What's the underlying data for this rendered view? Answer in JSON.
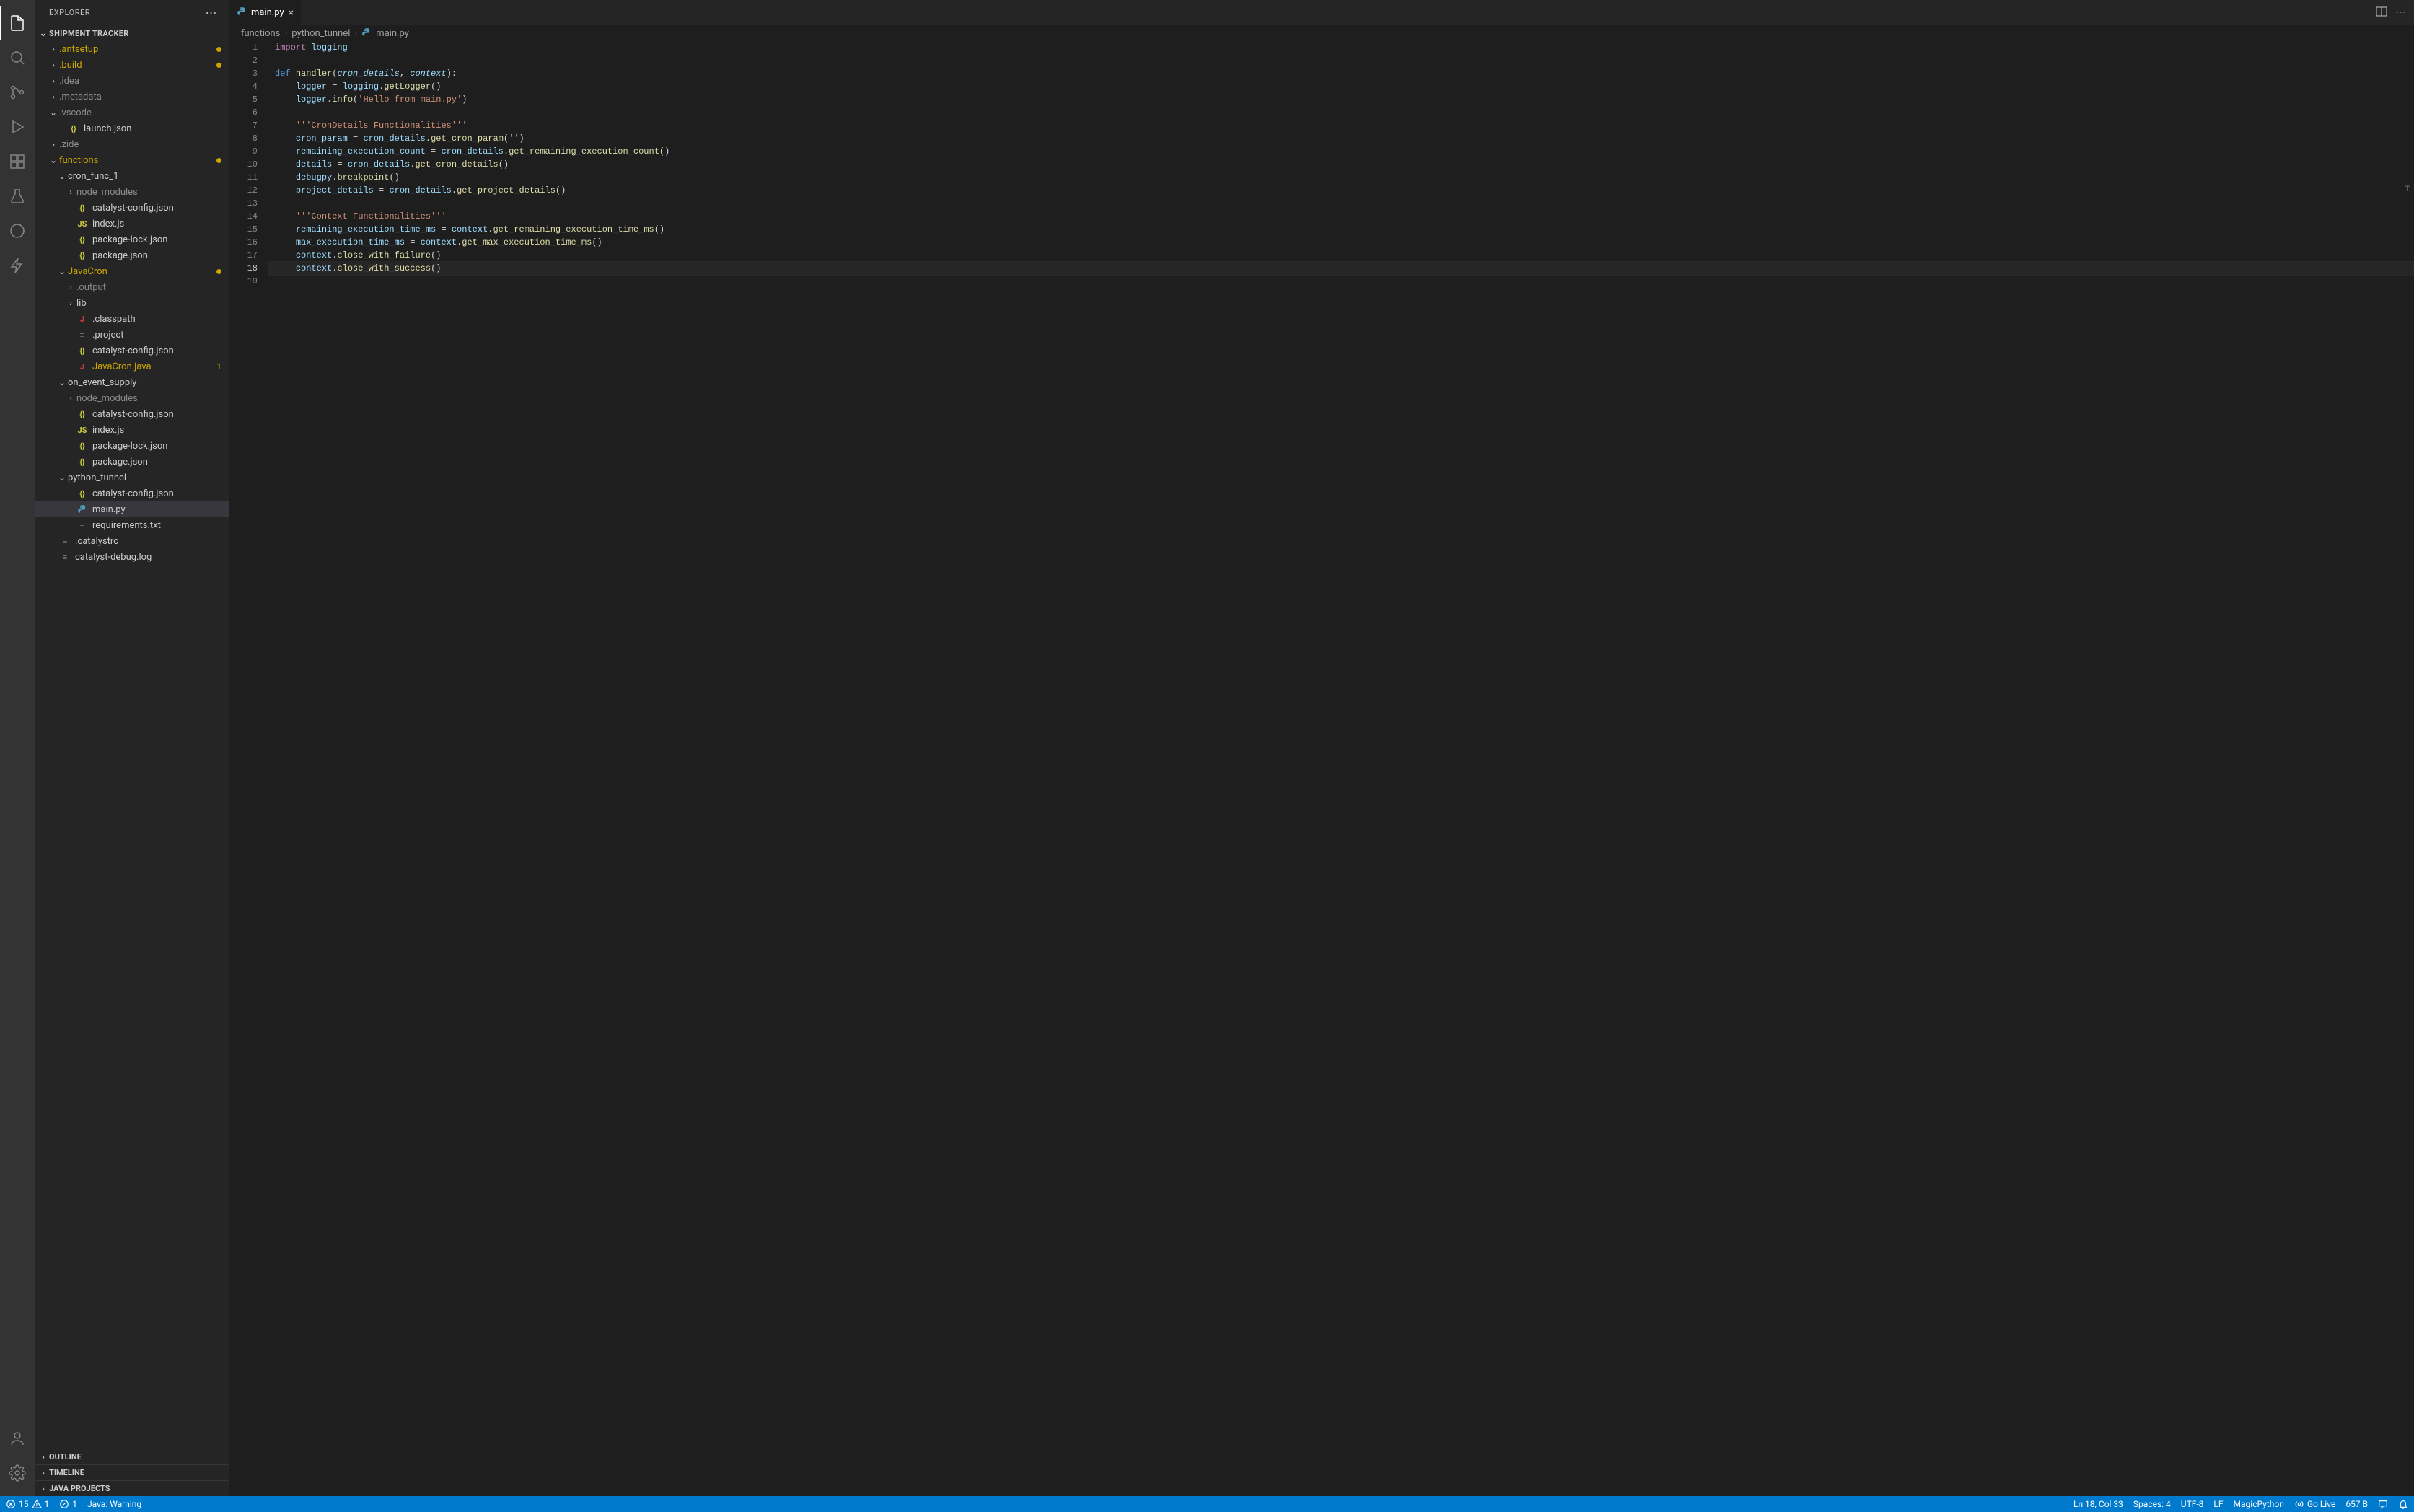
{
  "sidebar": {
    "title": "EXPLORER",
    "sections": {
      "workspace": "SHIPMENT TRACKER",
      "outline": "OUTLINE",
      "timeline": "TIMELINE",
      "javaProjects": "JAVA PROJECTS"
    }
  },
  "tree": [
    {
      "label": ".antsetup",
      "depth": 1,
      "kind": "folder",
      "twist": "right",
      "modified": true,
      "dot": true,
      "dim": false
    },
    {
      "label": ".build",
      "depth": 1,
      "kind": "folder",
      "twist": "right",
      "modified": true,
      "dot": true,
      "dim": false
    },
    {
      "label": ".idea",
      "depth": 1,
      "kind": "folder",
      "twist": "right",
      "dim": true
    },
    {
      "label": ".metadata",
      "depth": 1,
      "kind": "folder",
      "twist": "right",
      "dim": true
    },
    {
      "label": ".vscode",
      "depth": 1,
      "kind": "folder",
      "twist": "down",
      "dim": true
    },
    {
      "label": "launch.json",
      "depth": 2,
      "kind": "json"
    },
    {
      "label": ".zide",
      "depth": 1,
      "kind": "folder",
      "twist": "right",
      "dim": true
    },
    {
      "label": "functions",
      "depth": 1,
      "kind": "folder",
      "twist": "down",
      "modified": true,
      "dot": true
    },
    {
      "label": "cron_func_1",
      "depth": 2,
      "kind": "folder",
      "twist": "down"
    },
    {
      "label": "node_modules",
      "depth": 3,
      "kind": "folder",
      "twist": "right",
      "dim": true
    },
    {
      "label": "catalyst-config.json",
      "depth": 3,
      "kind": "json"
    },
    {
      "label": "index.js",
      "depth": 3,
      "kind": "js"
    },
    {
      "label": "package-lock.json",
      "depth": 3,
      "kind": "json"
    },
    {
      "label": "package.json",
      "depth": 3,
      "kind": "json"
    },
    {
      "label": "JavaCron",
      "depth": 2,
      "kind": "folder",
      "twist": "down",
      "modified": true,
      "dot": true
    },
    {
      "label": ".output",
      "depth": 3,
      "kind": "folder",
      "twist": "right",
      "dim": true
    },
    {
      "label": "lib",
      "depth": 3,
      "kind": "folder",
      "twist": "right"
    },
    {
      "label": ".classpath",
      "depth": 3,
      "kind": "java"
    },
    {
      "label": ".project",
      "depth": 3,
      "kind": "txt"
    },
    {
      "label": "catalyst-config.json",
      "depth": 3,
      "kind": "json"
    },
    {
      "label": "JavaCron.java",
      "depth": 3,
      "kind": "java",
      "modified": true,
      "badge": "1"
    },
    {
      "label": "on_event_supply",
      "depth": 2,
      "kind": "folder",
      "twist": "down"
    },
    {
      "label": "node_modules",
      "depth": 3,
      "kind": "folder",
      "twist": "right",
      "dim": true
    },
    {
      "label": "catalyst-config.json",
      "depth": 3,
      "kind": "json"
    },
    {
      "label": "index.js",
      "depth": 3,
      "kind": "js"
    },
    {
      "label": "package-lock.json",
      "depth": 3,
      "kind": "json"
    },
    {
      "label": "package.json",
      "depth": 3,
      "kind": "json"
    },
    {
      "label": "python_tunnel",
      "depth": 2,
      "kind": "folder",
      "twist": "down"
    },
    {
      "label": "catalyst-config.json",
      "depth": 3,
      "kind": "json"
    },
    {
      "label": "main.py",
      "depth": 3,
      "kind": "py",
      "selected": true
    },
    {
      "label": "requirements.txt",
      "depth": 3,
      "kind": "txt"
    },
    {
      "label": ".catalystrc",
      "depth": 1,
      "kind": "txt"
    },
    {
      "label": "catalyst-debug.log",
      "depth": 1,
      "kind": "txt"
    }
  ],
  "tab": {
    "label": "main.py"
  },
  "breadcrumbs": {
    "seg1": "functions",
    "seg2": "python_tunnel",
    "seg3": "main.py"
  },
  "code": [
    {
      "n": 1,
      "html": "<span class='tok-kw'>import</span> <span class='tok-var'>logging</span>"
    },
    {
      "n": 2,
      "html": ""
    },
    {
      "n": 3,
      "html": "<span class='tok-kw2'>def</span> <span class='tok-fn'>handler</span>(<span class='tok-param'>cron_details</span>, <span class='tok-param'>context</span>):"
    },
    {
      "n": 4,
      "html": "    <span class='tok-var'>logger</span> = <span class='tok-var'>logging</span>.<span class='tok-fn'>getLogger</span>()"
    },
    {
      "n": 5,
      "html": "    <span class='tok-var'>logger</span>.<span class='tok-fn'>info</span>(<span class='tok-str'>'Hello from main.py'</span>)"
    },
    {
      "n": 6,
      "html": ""
    },
    {
      "n": 7,
      "html": "    <span class='tok-str'>'''CronDetails Functionalities'''</span>"
    },
    {
      "n": 8,
      "html": "    <span class='tok-var'>cron_param</span> = <span class='tok-var'>cron_details</span>.<span class='tok-fn'>get_cron_param</span>(<span class='tok-str'>''</span>)"
    },
    {
      "n": 9,
      "html": "    <span class='tok-var'>remaining_execution_count</span> = <span class='tok-var'>cron_details</span>.<span class='tok-fn'>get_remaining_execution_count</span>()"
    },
    {
      "n": 10,
      "html": "    <span class='tok-var'>details</span> = <span class='tok-var'>cron_details</span>.<span class='tok-fn'>get_cron_details</span>()"
    },
    {
      "n": 11,
      "html": "    <span class='tok-var'>debugpy</span>.<span class='tok-fn'>breakpoint</span>()"
    },
    {
      "n": 12,
      "html": "    <span class='tok-var'>project_details</span> = <span class='tok-var'>cron_details</span>.<span class='tok-fn'>get_project_details</span>()"
    },
    {
      "n": 13,
      "html": ""
    },
    {
      "n": 14,
      "html": "    <span class='tok-str'>'''Context Functionalities'''</span>"
    },
    {
      "n": 15,
      "html": "    <span class='tok-var'>remaining_execution_time_ms</span> = <span class='tok-var'>context</span>.<span class='tok-fn'>get_remaining_execution_time_ms</span>()"
    },
    {
      "n": 16,
      "html": "    <span class='tok-var'>max_execution_time_ms</span> = <span class='tok-var'>context</span>.<span class='tok-fn'>get_max_execution_time_ms</span>()"
    },
    {
      "n": 17,
      "html": "    <span class='tok-var'>context</span>.<span class='tok-fn'>close_with_failure</span>()"
    },
    {
      "n": 18,
      "html": "    <span class='tok-var'>context</span>.<span class='tok-fn'>close_with_success</span>()",
      "current": true
    },
    {
      "n": 19,
      "html": ""
    }
  ],
  "status": {
    "errors": "15",
    "warnings": "1",
    "ports": "1",
    "java": "Java: Warning",
    "cursor": "Ln 18, Col 33",
    "spaces": "Spaces: 4",
    "encoding": "UTF-8",
    "eol": "LF",
    "lang": "MagicPython",
    "golive": "Go Live",
    "size": "657 B"
  }
}
